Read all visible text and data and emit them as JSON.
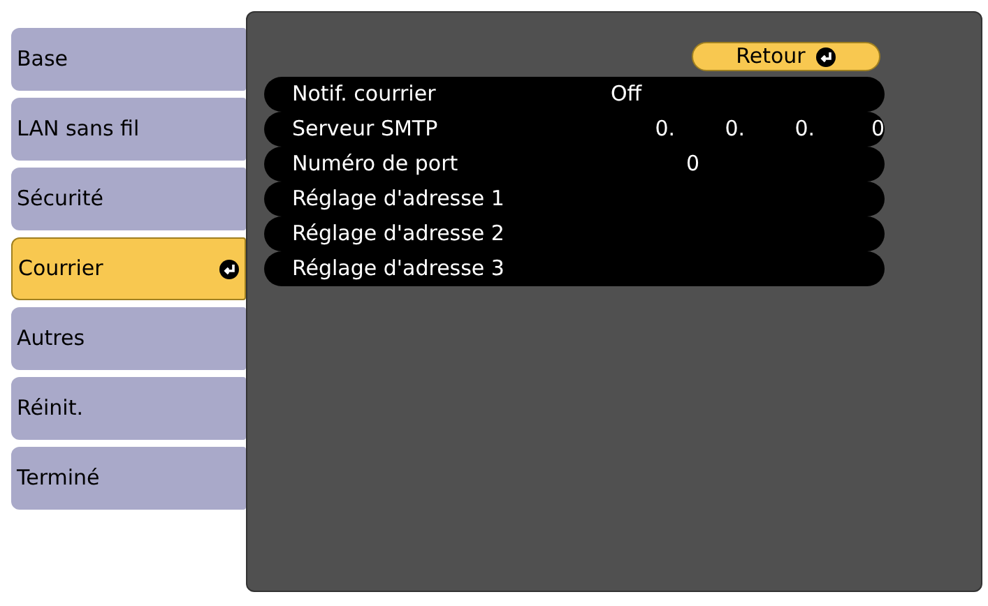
{
  "sidebar": {
    "items": [
      {
        "label": "Base",
        "selected": false
      },
      {
        "label": "LAN sans fil",
        "selected": false
      },
      {
        "label": "Sécurité",
        "selected": false
      },
      {
        "label": "Courrier",
        "selected": true
      },
      {
        "label": "Autres",
        "selected": false
      },
      {
        "label": "Réinit.",
        "selected": false
      },
      {
        "label": "Terminé",
        "selected": false
      }
    ]
  },
  "back_button": {
    "label": "Retour"
  },
  "settings": [
    {
      "kind": "text",
      "label": "Notif. courrier",
      "value": "Off"
    },
    {
      "kind": "ip",
      "label": "Serveur SMTP",
      "values": [
        "0.",
        "0.",
        "0.",
        "0"
      ]
    },
    {
      "kind": "number",
      "label": "Numéro de port",
      "value": "0"
    },
    {
      "kind": "empty",
      "label": "Réglage d'adresse 1"
    },
    {
      "kind": "empty",
      "label": "Réglage d'adresse 2"
    },
    {
      "kind": "empty",
      "label": "Réglage d'adresse 3"
    }
  ]
}
